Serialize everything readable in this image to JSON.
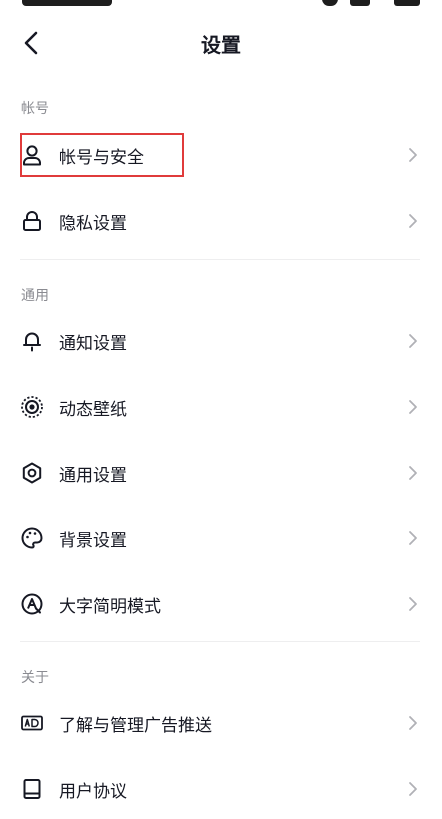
{
  "header": {
    "title": "设置"
  },
  "sections": {
    "account": {
      "label": "帐号",
      "items": [
        {
          "label": "帐号与安全",
          "icon": "person-icon"
        },
        {
          "label": "隐私设置",
          "icon": "lock-icon"
        }
      ]
    },
    "general": {
      "label": "通用",
      "items": [
        {
          "label": "通知设置",
          "icon": "bell-icon"
        },
        {
          "label": "动态壁纸",
          "icon": "live-wallpaper-icon"
        },
        {
          "label": "通用设置",
          "icon": "gear-icon"
        },
        {
          "label": "背景设置",
          "icon": "palette-icon"
        },
        {
          "label": "大字简明模式",
          "icon": "large-text-icon"
        }
      ]
    },
    "about": {
      "label": "关于",
      "items": [
        {
          "label": "了解与管理广告推送",
          "icon": "ad-icon"
        },
        {
          "label": "用户协议",
          "icon": "document-icon"
        }
      ]
    }
  },
  "colors": {
    "text": "#161823",
    "secondary_text": "#8a8b91",
    "chevron": "#b0b1b6",
    "highlight": "#e03b3b"
  }
}
